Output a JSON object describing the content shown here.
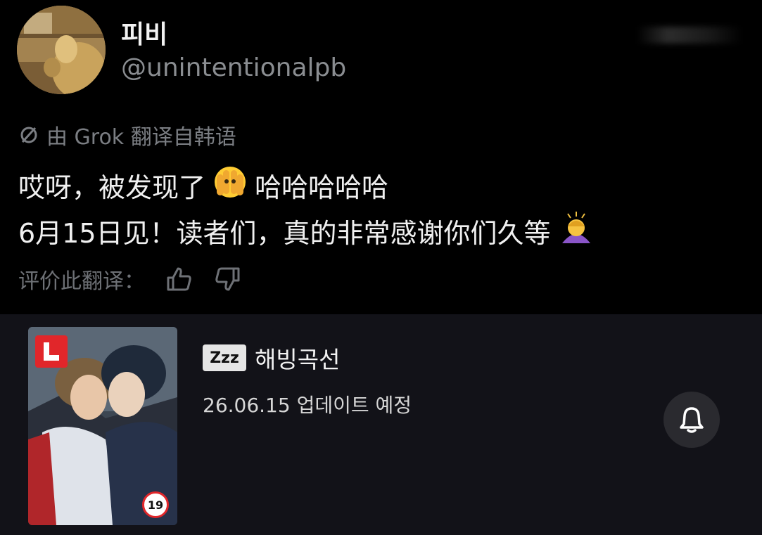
{
  "tweet": {
    "display_name": "피비",
    "handle": "@unintentionalpb",
    "translated_label": "由 Grok 翻译自韩语",
    "line1_before": "哎呀，被发现了",
    "line1_after": "哈哈哈哈哈",
    "line2": "6月15日见！读者们，真的非常感谢你们久等",
    "emoji1": "face-with-peeking-eye",
    "emoji2": "person-bowing",
    "rate_label": "评价此翻译：",
    "thumbs_up_icon": "thumbs-up-icon",
    "thumbs_down_icon": "thumbs-down-icon"
  },
  "card": {
    "badge": "Zzz",
    "title": "해빙곡선",
    "date_text": "26.06.15 업데이트 예정",
    "age_rating": "19",
    "bell_icon": "bell-icon"
  },
  "colors": {
    "background": "#000000",
    "card_background": "#121218",
    "muted_text": "#7b7e83",
    "accent_red": "#e1262a"
  }
}
